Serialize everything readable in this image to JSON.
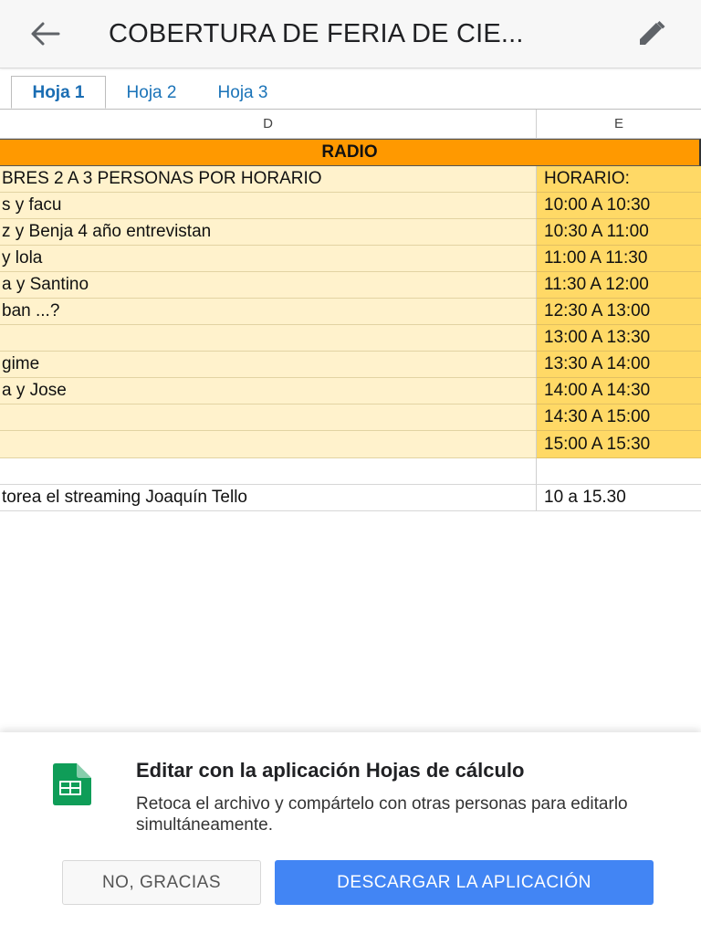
{
  "appbar": {
    "title": "COBERTURA DE FERIA DE CIE...",
    "back_icon": "arrow-left-icon",
    "edit_icon": "pencil-icon"
  },
  "tabs": [
    {
      "label": "Hoja 1",
      "active": true
    },
    {
      "label": "Hoja 2",
      "active": false
    },
    {
      "label": "Hoja 3",
      "active": false
    }
  ],
  "grid": {
    "columns": [
      "D",
      "E"
    ],
    "section_header": "RADIO",
    "rows": [
      {
        "d": "BRES 2 A 3 PERSONAS POR HORARIO",
        "e": "HORARIO:"
      },
      {
        "d": "s y facu",
        "e": "10:00 A 10:30"
      },
      {
        "d": "z y Benja 4 año entrevistan",
        "e": "10:30 A 11:00"
      },
      {
        "d": " y lola",
        "e": "11:00 A 11:30"
      },
      {
        "d": "a y Santino",
        "e": "11:30 A 12:00"
      },
      {
        "d": "ban ...?",
        "e": "12:30 A 13:00"
      },
      {
        "d": "",
        "e": "13:00 A 13:30"
      },
      {
        "d": " gime",
        "e": "13:30 A 14:00"
      },
      {
        "d": "a y Jose",
        "e": "14:00 A 14:30"
      },
      {
        "d": "",
        "e": "14:30 A 15:00"
      },
      {
        "d": "",
        "e": "15:00 A 15:30"
      }
    ],
    "empty_row": {
      "d": "",
      "e": ""
    },
    "footer_row": {
      "d": "torea el streaming Joaquín Tello",
      "e": "10 a 15.30"
    }
  },
  "sheet": {
    "icon": "google-sheets-icon",
    "title": "Editar con la aplicación Hojas de cálculo",
    "description": "Retoca el archivo y compártelo con otras personas para editarlo simultáneamente.",
    "no_label": "NO, GRACIAS",
    "download_label": "DESCARGAR LA APLICACIÓN"
  },
  "colors": {
    "orange_header": "#ff9900",
    "light_yellow": "#fff2cc",
    "dark_yellow": "#ffd966",
    "accent_blue": "#4285f4",
    "sheets_green": "#0f9d58"
  }
}
